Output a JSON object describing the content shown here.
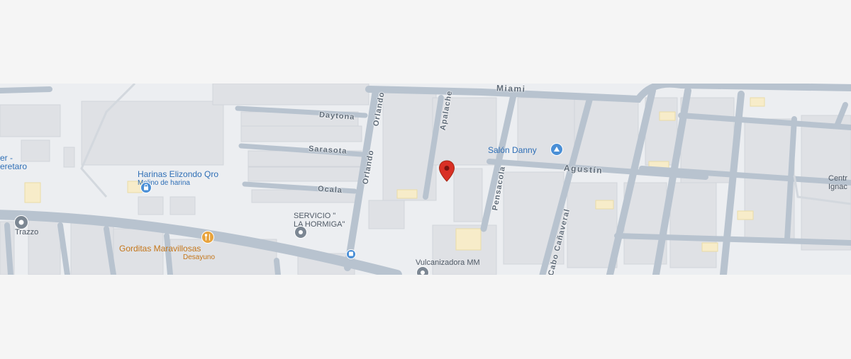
{
  "streets": {
    "miami": "Miami",
    "agustin": "Agustín",
    "daytona": "Daytona",
    "sarasota": "Sarasota",
    "ocala": "Ocala",
    "orlando_upper": "Orlando",
    "orlando_lower": "Orlando",
    "apalache": "Apalache",
    "pensacola": "Pensacola",
    "cabo_canaveral": "Cabo Cañaveral"
  },
  "places": {
    "harinas": {
      "name": "Harinas Elizondo Qro",
      "category": "Molino de harina"
    },
    "gorditas": {
      "name": "Gorditas Maravillosas",
      "category": "Desayuno"
    },
    "salon": {
      "name": "Salón Danny"
    },
    "servicio_line1": "SERVICIO \"",
    "servicio_line2": "LA HORMIGA\"",
    "vulcanizadora": "Vulcanizadora MM",
    "trazzo": "Trazzo",
    "left_cut_line1": "er -",
    "left_cut_line2": "eretaro",
    "right_cut_line1": "Centr",
    "right_cut_line2": "Ignac"
  },
  "icons": {
    "marker": "location-pin-icon",
    "shop": "shopping-bag-icon",
    "restaurant": "fork-knife-icon",
    "salon": "salon-icon",
    "generic": "place-dot-icon",
    "bus": "bus-stop-icon"
  },
  "colors": {
    "road": "#b8c3cf",
    "block": "#dfe1e5",
    "background": "#eceef1",
    "marker": "#d93025",
    "poi_blue": "#4a8fd6",
    "poi_orange": "#e8a33c",
    "poi_gray": "#7c8793",
    "commercial": "#f7ecc9"
  }
}
